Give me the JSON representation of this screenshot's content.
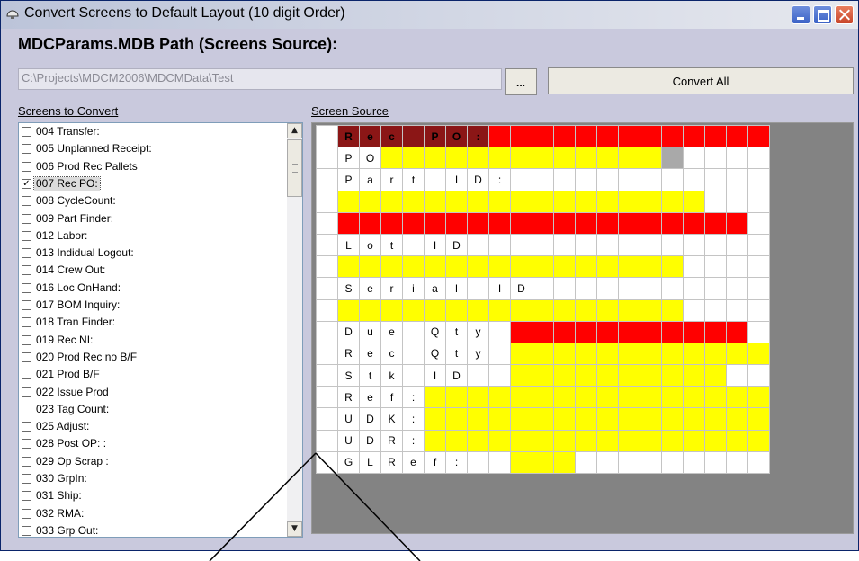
{
  "window": {
    "title": "Convert Screens to Default Layout (10 digit Order)",
    "icon": "monitor-icon"
  },
  "path_section": {
    "label": "MDCParams.MDB Path (Screens Source):",
    "path_value": "C:\\Projects\\MDCM2006\\MDCMData\\Test",
    "browse_label": "...",
    "convert_all_label": "Convert All"
  },
  "list_section": {
    "label": "Screens to Convert",
    "items": [
      {
        "label": "004 Transfer:",
        "checked": false
      },
      {
        "label": "005 Unplanned Receipt:",
        "checked": false
      },
      {
        "label": "006 Prod Rec Pallets",
        "checked": false
      },
      {
        "label": "007 Rec PO:",
        "checked": true,
        "selected": true
      },
      {
        "label": "008 CycleCount:",
        "checked": false
      },
      {
        "label": "009 Part Finder:",
        "checked": false
      },
      {
        "label": "012 Labor:",
        "checked": false
      },
      {
        "label": "013 Indidual  Logout:",
        "checked": false
      },
      {
        "label": "014 Crew Out:",
        "checked": false
      },
      {
        "label": "016 Loc OnHand:",
        "checked": false
      },
      {
        "label": "017 BOM Inquiry:",
        "checked": false
      },
      {
        "label": "018 Tran Finder:",
        "checked": false
      },
      {
        "label": "019 Rec NI:",
        "checked": false
      },
      {
        "label": "020 Prod Rec no B/F",
        "checked": false
      },
      {
        "label": "021 Prod B/F",
        "checked": false
      },
      {
        "label": "022 Issue Prod",
        "checked": false
      },
      {
        "label": "023 Tag Count:",
        "checked": false
      },
      {
        "label": "025 Adjust:",
        "checked": false
      },
      {
        "label": "028 Post OP:   :",
        "checked": false
      },
      {
        "label": "029 Op Scrap   :",
        "checked": false
      },
      {
        "label": "030 GrpIn:",
        "checked": false
      },
      {
        "label": "031 Ship:",
        "checked": false
      },
      {
        "label": "032 RMA:",
        "checked": false
      },
      {
        "label": "033 Grp Out:",
        "checked": false
      }
    ]
  },
  "source_section": {
    "label": "Screen Source",
    "colors": {
      "yellow": "#ffff00",
      "red": "#ff0000",
      "dark_red": "#8b1616",
      "gray": "#a9a9a9",
      "panel": "#838383"
    },
    "rows": [
      {
        "cells": [
          "",
          "R",
          "e",
          "c",
          "",
          "P",
          "O",
          ":",
          "",
          "",
          "",
          "",
          "",
          "",
          "",
          "",
          "",
          "",
          "",
          "",
          ""
        ],
        "colors": ".DDDDDDDRRRRRRRRRRRRR"
      },
      {
        "cells": [
          "",
          "P",
          "O",
          "",
          "",
          "",
          "",
          "",
          "",
          "",
          "",
          "",
          "",
          "",
          "",
          "",
          "",
          "",
          "",
          "",
          ""
        ],
        "colors": "...YYYYYYYYYYYYYG...."
      },
      {
        "cells": [
          "",
          "P",
          "a",
          "r",
          "t",
          "",
          "I",
          "D",
          ":",
          "",
          "",
          "",
          "",
          "",
          "",
          "",
          "",
          "",
          "",
          "",
          ""
        ],
        "colors": "....................."
      },
      {
        "cells": [
          "",
          "",
          "",
          "",
          "",
          "",
          "",
          "",
          "",
          "",
          "",
          "",
          "",
          "",
          "",
          "",
          "",
          "",
          "",
          "",
          ""
        ],
        "colors": ".YYYYYYYYYYYYYYYYY..."
      },
      {
        "cells": [
          "",
          "",
          "",
          "",
          "",
          "",
          "",
          "",
          "",
          "",
          "",
          "",
          "",
          "",
          "",
          "",
          "",
          "",
          "",
          "",
          ""
        ],
        "colors": ".RRRRRRRRRRRRRRRRRRR."
      },
      {
        "cells": [
          "",
          "L",
          "o",
          "t",
          "",
          "I",
          "D",
          "",
          "",
          "",
          "",
          "",
          "",
          "",
          "",
          "",
          "",
          "",
          "",
          "",
          ""
        ],
        "colors": "....................."
      },
      {
        "cells": [
          "",
          "",
          "",
          "",
          "",
          "",
          "",
          "",
          "",
          "",
          "",
          "",
          "",
          "",
          "",
          "",
          "",
          "",
          "",
          "",
          ""
        ],
        "colors": ".YYYYYYYYYYYYYYYY...."
      },
      {
        "cells": [
          "",
          "S",
          "e",
          "r",
          "i",
          "a",
          "l",
          "",
          "I",
          "D",
          "",
          "",
          "",
          "",
          "",
          "",
          "",
          "",
          "",
          "",
          ""
        ],
        "colors": "....................."
      },
      {
        "cells": [
          "",
          "",
          "",
          "",
          "",
          "",
          "",
          "",
          "",
          "",
          "",
          "",
          "",
          "",
          "",
          "",
          "",
          "",
          "",
          "",
          ""
        ],
        "colors": ".YYYYYYYYYYYYYYYY...."
      },
      {
        "cells": [
          "",
          "D",
          "u",
          "e",
          "",
          "Q",
          "t",
          "y",
          "",
          "",
          "",
          "",
          "",
          "",
          "",
          "",
          "",
          "",
          "",
          "",
          ""
        ],
        "colors": ".........RRRRRRRRRRR."
      },
      {
        "cells": [
          "",
          "R",
          "e",
          "c",
          "",
          "Q",
          "t",
          "y",
          "",
          "",
          "",
          "",
          "",
          "",
          "",
          "",
          "",
          "",
          "",
          "",
          ""
        ],
        "colors": ".........YYYYYYYYYYYY"
      },
      {
        "cells": [
          "",
          "S",
          "t",
          "k",
          "",
          "I",
          "D",
          "",
          "",
          "",
          "",
          "",
          "",
          "",
          "",
          "",
          "",
          "",
          "",
          "",
          ""
        ],
        "colors": ".........YYYYYYYYYY.."
      },
      {
        "cells": [
          "",
          "R",
          "e",
          "f",
          ":",
          "",
          "",
          "",
          "",
          "",
          "",
          "",
          "",
          "",
          "",
          "",
          "",
          "",
          "",
          "",
          ""
        ],
        "colors": ".....YYYYYYYYYYYYYYYY"
      },
      {
        "cells": [
          "",
          "U",
          "D",
          "K",
          ":",
          "",
          "",
          "",
          "",
          "",
          "",
          "",
          "",
          "",
          "",
          "",
          "",
          "",
          "",
          "",
          ""
        ],
        "colors": ".....YYYYYYYYYYYYYYYY"
      },
      {
        "cells": [
          "",
          "U",
          "D",
          "R",
          ":",
          "",
          "",
          "",
          "",
          "",
          "",
          "",
          "",
          "",
          "",
          "",
          "",
          "",
          "",
          "",
          ""
        ],
        "colors": ".....YYYYYYYYYYYYYYYY"
      },
      {
        "cells": [
          "",
          "G",
          "L",
          "R",
          "e",
          "f",
          ":",
          "",
          "",
          "",
          "",
          "",
          "",
          "",
          "",
          "",
          "",
          "",
          "",
          "",
          ""
        ],
        "colors": ".........YYY........."
      }
    ]
  }
}
